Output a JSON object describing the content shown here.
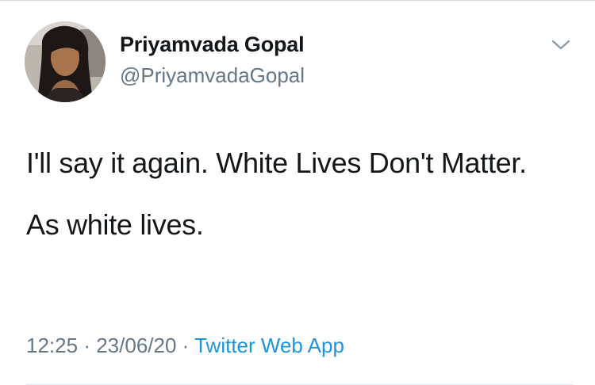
{
  "tweet": {
    "author": {
      "display_name": "Priyamvada Gopal",
      "handle": "@PriyamvadaGopal"
    },
    "text_paragraphs": [
      "I'll say it again. White Lives Don't Matter.",
      "As white lives."
    ],
    "time": "12:25",
    "separator": "·",
    "date": "23/06/20",
    "source": "Twitter Web App"
  },
  "icons": {
    "more": "chevron-down-icon"
  },
  "colors": {
    "text_primary": "#14171a",
    "text_secondary": "#657786",
    "link": "#1b95e0"
  }
}
